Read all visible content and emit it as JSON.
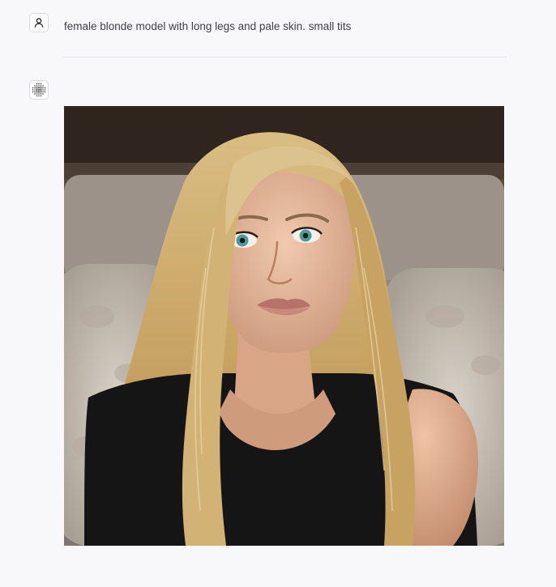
{
  "conversation": {
    "user_message": {
      "text": "female blonde model with long legs and pale skin. small tits",
      "avatar_icon": "user-icon"
    },
    "assistant_message": {
      "avatar_icon": "dot-grid-logo-icon",
      "image": {
        "description_icon": "generated-image"
      }
    }
  },
  "colors": {
    "page_background": "#f8f8fa",
    "text": "#3f3f46",
    "divider": "#e2e2e7",
    "avatar_border": "#d9d9df"
  }
}
